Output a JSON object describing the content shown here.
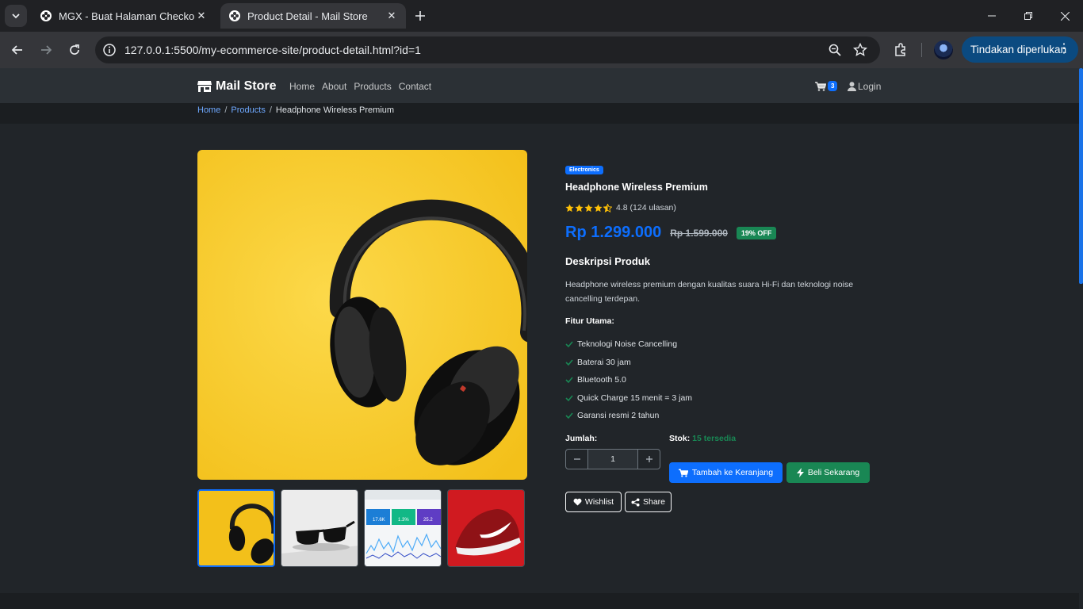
{
  "browser": {
    "tabs": [
      {
        "title": "MGX - Buat Halaman Checkout"
      },
      {
        "title": "Product Detail - Mail Store"
      }
    ],
    "url": "127.0.0.1:5500/my-ecommerce-site/product-detail.html?id=1",
    "action_button": "Tindakan diperlukan"
  },
  "navbar": {
    "brand": "Mail Store",
    "links": [
      "Home",
      "About",
      "Products",
      "Contact"
    ],
    "cart_count": "3",
    "login": "Login"
  },
  "breadcrumb": {
    "home": "Home",
    "products": "Products",
    "current": "Headphone Wireless Premium"
  },
  "product": {
    "category": "Electronics",
    "title": "Headphone Wireless Premium",
    "rating": "4.8 (124 ulasan)",
    "rating_value": 4.8,
    "price": "Rp 1.299.000",
    "old_price": "Rp 1.599.000",
    "discount": "19% OFF",
    "description_heading": "Deskripsi Produk",
    "description": "Headphone wireless premium dengan kualitas suara Hi-Fi dan teknologi noise cancelling terdepan.",
    "features_heading": "Fitur Utama:",
    "features": [
      "Teknologi Noise Cancelling",
      "Baterai 30 jam",
      "Bluetooth 5.0",
      "Quick Charge 15 menit = 3 jam",
      "Garansi resmi 2 tahun"
    ],
    "qty_label": "Jumlah:",
    "qty_value": "1",
    "stock_label": "Stok:",
    "stock_value": "15 tersedia",
    "add_to_cart": "Tambah ke Keranjang",
    "buy_now": "Beli Sekarang",
    "wishlist": "Wishlist",
    "share": "Share",
    "thumb_stats": [
      "17.6K",
      "1.3%",
      "25.2"
    ]
  },
  "colors": {
    "primary": "#0d6efd",
    "success": "#198754",
    "page_bg": "#212529",
    "navbar_bg": "#2b3035",
    "image_bg": "#f5c518"
  }
}
